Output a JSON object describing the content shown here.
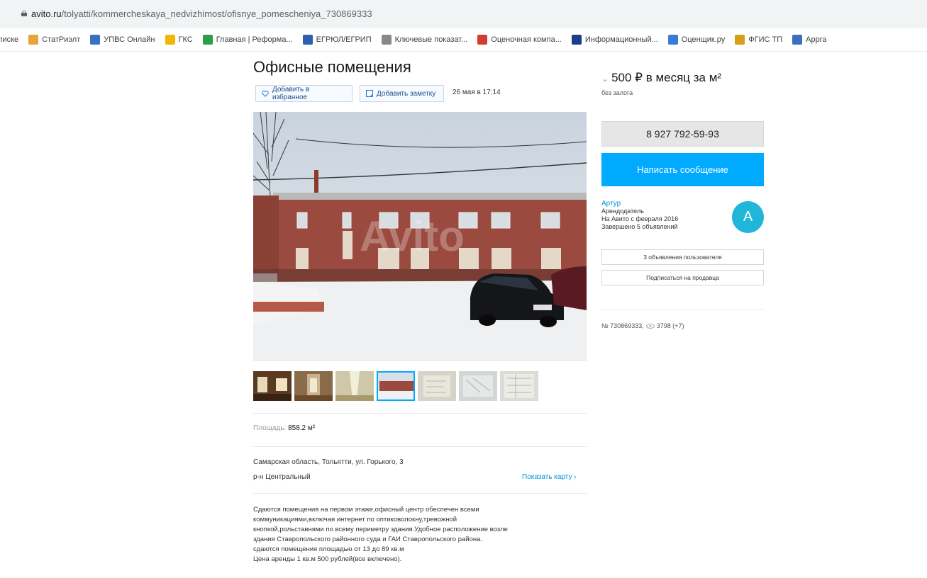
{
  "address_bar": {
    "host": "avito.ru",
    "path": "/tolyatti/kommercheskaya_nedvizhimost/ofisnye_pomescheniya_730869333"
  },
  "bookmarks": [
    {
      "label": "списке",
      "icon": "",
      "color": ""
    },
    {
      "label": "СтатРиэлт",
      "icon": "statrielt-icon",
      "color": "#e8a33a"
    },
    {
      "label": "УПВС Онлайн",
      "icon": "upvs-icon",
      "color": "#3a6fc1"
    },
    {
      "label": "ГКС",
      "icon": "gks-icon",
      "color": "#f2b705"
    },
    {
      "label": "Главная | Реформа...",
      "icon": "reforma-icon",
      "color": "#2e9e44"
    },
    {
      "label": "ЕГРЮЛ/ЕГРИП",
      "icon": "egrul-icon",
      "color": "#2d5fb0"
    },
    {
      "label": "Ключевые показат...",
      "icon": "key-indicators-icon",
      "color": "#888888"
    },
    {
      "label": "Оценочная компа...",
      "icon": "valuation-company-icon",
      "color": "#d43c2f"
    },
    {
      "label": "Информационный...",
      "icon": "info-portal-icon",
      "color": "#1a3f8a"
    },
    {
      "label": "Оценщик.ру",
      "icon": "ocenschik-icon",
      "color": "#3a7bd5"
    },
    {
      "label": "ФГИС ТП",
      "icon": "fgis-icon",
      "color": "#d4a017"
    },
    {
      "label": "Appra",
      "icon": "appra-icon",
      "color": "#3a6fc1"
    }
  ],
  "listing": {
    "title": "Офисные помещения",
    "favorite_label": "Добавить в избранное",
    "note_label": "Добавить заметку",
    "date": "26 мая в 17:14",
    "params": {
      "area_label": "Площадь:",
      "area_value": "858.2 м²"
    },
    "address_line1": "Самарская область, Тольятти, ул. Горького, 3",
    "address_line2": "р-н Центральный",
    "show_map": "Показать карту ›",
    "description": [
      "Сдаются помещения на первом этаже,офисный центр обеспечен всеми",
      "коммуникациями,включая интернет по оптиковолокну,тревожной",
      "кнопкой,рольставнями по всему периметру здания.Удобное расположение возле",
      "здания Ставропольского районного суда и ГАИ Ставропольского района.",
      "сдаются помещения площадью от 13 до 89 кв.м",
      "Цена аренды 1 кв.м 500 рублей(все включено)."
    ],
    "watermark": "Avito"
  },
  "sidebar": {
    "price": "500 ₽ в месяц за м²",
    "deposit": "без залога",
    "phone": "8 927 792-59-93",
    "message_button": "Написать сообщение",
    "seller_name": "Артур",
    "seller_role": "Арендодатель",
    "seller_since": "На Авито с февраля 2016",
    "seller_completed": "Завершено 5 объявлений",
    "avatar_letter": "А",
    "user_listings_button": "3 объявления пользователя",
    "subscribe_button": "Подписаться на продавца",
    "item_number": "№ 730869333,",
    "views": "3798 (+7)"
  },
  "colors": {
    "accent": "#00aaff",
    "link": "#0091d9",
    "avatar": "#1fb6d9"
  }
}
